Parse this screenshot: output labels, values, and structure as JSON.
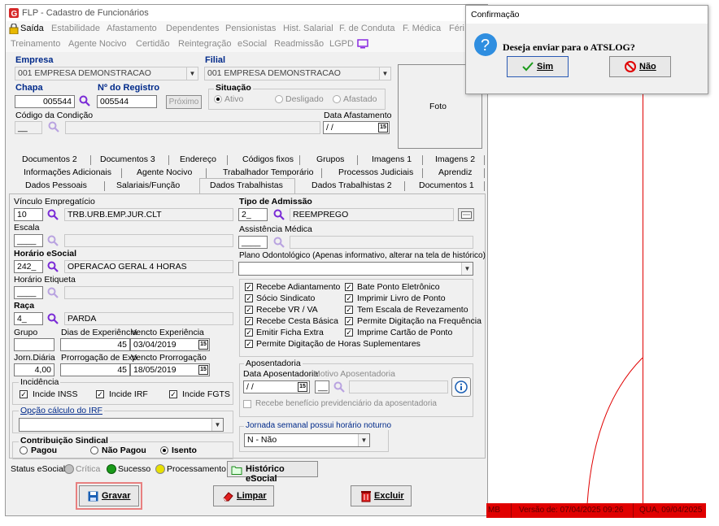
{
  "window": {
    "title": "FLP - Cadastro de Funcionários"
  },
  "menu": {
    "row1": [
      "Saída",
      "Estabilidade",
      "Afastamento",
      "Dependentes",
      "Pensionistas",
      "Hist. Salarial",
      "F. de Conduta",
      "F. Médica",
      "Féri"
    ],
    "row2": [
      "Treinamento",
      "Agente Nocivo",
      "Certidão",
      "Reintegração",
      "eSocial",
      "Readmissão",
      "LGPD"
    ]
  },
  "header": {
    "empresa_label": "Empresa",
    "empresa_value": "001 EMPRESA DEMONSTRACAO",
    "filial_label": "Filial",
    "filial_value": "001 EMPRESA DEMONSTRACAO",
    "chapa_label": "Chapa",
    "chapa_value": "005544",
    "registro_label": "Nº do Registro",
    "registro_value": "005544",
    "proximo_label": "Próximo",
    "situacao_label": "Situação",
    "situacao_options": [
      "Ativo",
      "Desligado",
      "Afastado"
    ],
    "codigo_condicao_label": "Código da Condição",
    "codigo_condicao_value": "__",
    "data_afastamento_label": "Data Afastamento",
    "data_afastamento_value": "/ /",
    "foto_label": "Foto"
  },
  "tabs": {
    "row1": [
      "Documentos 2",
      "Documentos 3",
      "Endereço",
      "Códigos fixos",
      "Grupos",
      "Imagens 1",
      "Imagens 2"
    ],
    "row2": [
      "Informações Adicionais",
      "Agente Nocivo",
      "Trabalhador Temporário",
      "Processos Judiciais",
      "Aprendiz"
    ],
    "row3": [
      "Dados Pessoais",
      "Salariais/Função",
      "Dados Trabalhistas",
      "Dados Trabalhistas 2",
      "Documentos 1"
    ]
  },
  "left": {
    "vinculo_label": "Vínculo Empregatício",
    "vinculo_code": "10",
    "vinculo_desc": "TRB.URB.EMP.JUR.CLT",
    "escala_label": "Escala",
    "escala_code": "____",
    "horario_label": "Horário eSocial",
    "horario_code": "242_",
    "horario_desc": "OPERACAO GERAL 4 HORAS",
    "horario_etiqueta_label": "Horário Etiqueta",
    "horario_etiqueta_code": "____",
    "raca_label": "Raça",
    "raca_code": "4_",
    "raca_desc": "PARDA",
    "grupo_label": "Grupo",
    "dias_exp_label": "Dias de Experiência",
    "dias_exp_value": "45",
    "vencto_exp_label": "Vencto Experiência",
    "vencto_exp_value": "03/04/2019",
    "jorn_label": "Jorn.Diária",
    "jorn_value": "4,00",
    "prorrogacao_label": "Prorrogação de Exp.",
    "prorrogacao_value": "45",
    "vencto_prorr_label": "Vencto Prorrogação",
    "vencto_prorr_value": "18/05/2019",
    "incidencia_label": "Incidência",
    "incidencias": [
      "Incide INSS",
      "Incide IRF",
      "Incide FGTS"
    ],
    "irf_label": "Opção cálculo do IRF",
    "contrib_label": "Contribuição Sindical",
    "contrib_options": [
      "Pagou",
      "Não Pagou",
      "Isento"
    ]
  },
  "right": {
    "tipo_admissao_label": "Tipo de Admissão",
    "tipo_admissao_code": "2_",
    "tipo_admissao_desc": "REEMPREGO",
    "assistencia_label": "Assistência Médica",
    "assistencia_code": "____",
    "plano_label": "Plano Odontológico (Apenas informativo, alterar na tela de histórico)",
    "checks_left": [
      "Recebe Adiantamento",
      "Sócio Sindicato",
      "Recebe VR / VA",
      "Recebe Cesta Básica",
      "Emitir Ficha Extra",
      "Permite Digitação de Horas Suplementares"
    ],
    "checks_right": [
      "Bate Ponto Eletrônico",
      "Imprimir Livro de Ponto",
      "Tem Escala de Revezamento",
      "Permite Digitação na Frequência",
      "Imprime Cartão de Ponto"
    ],
    "aposentadoria_label": "Aposentadoria",
    "data_aposentadoria_label": "Data Aposentadoria",
    "data_aposentadoria_value": "/ /",
    "motivo_label": "Motivo Aposentadoria",
    "motivo_code": "__",
    "beneficio_label": "Recebe benefício previdenciário da aposentadoria",
    "jornada_label": "Jornada semanal possui horário noturno",
    "jornada_value": "N - Não"
  },
  "esocial": {
    "status_label": "Status eSocial:",
    "legend": [
      "Crítica",
      "Sucesso",
      "Processamento"
    ],
    "legend_colors": [
      "#c0c0c0",
      "#1a9a1a",
      "#e8e000"
    ],
    "historico_label": "Histórico eSocial"
  },
  "buttons": {
    "gravar": "Gravar",
    "limpar": "Limpar",
    "excluir": "Excluir"
  },
  "dialog": {
    "title": "Confirmação",
    "message": "Deseja enviar para o ATSLOG?",
    "sim": "Sim",
    "nao": "Não"
  },
  "statusbar": {
    "version": "Versão de: 07/04/2025 09:26",
    "date": "QUA, 09/04/2025",
    "fragment": "MB"
  }
}
